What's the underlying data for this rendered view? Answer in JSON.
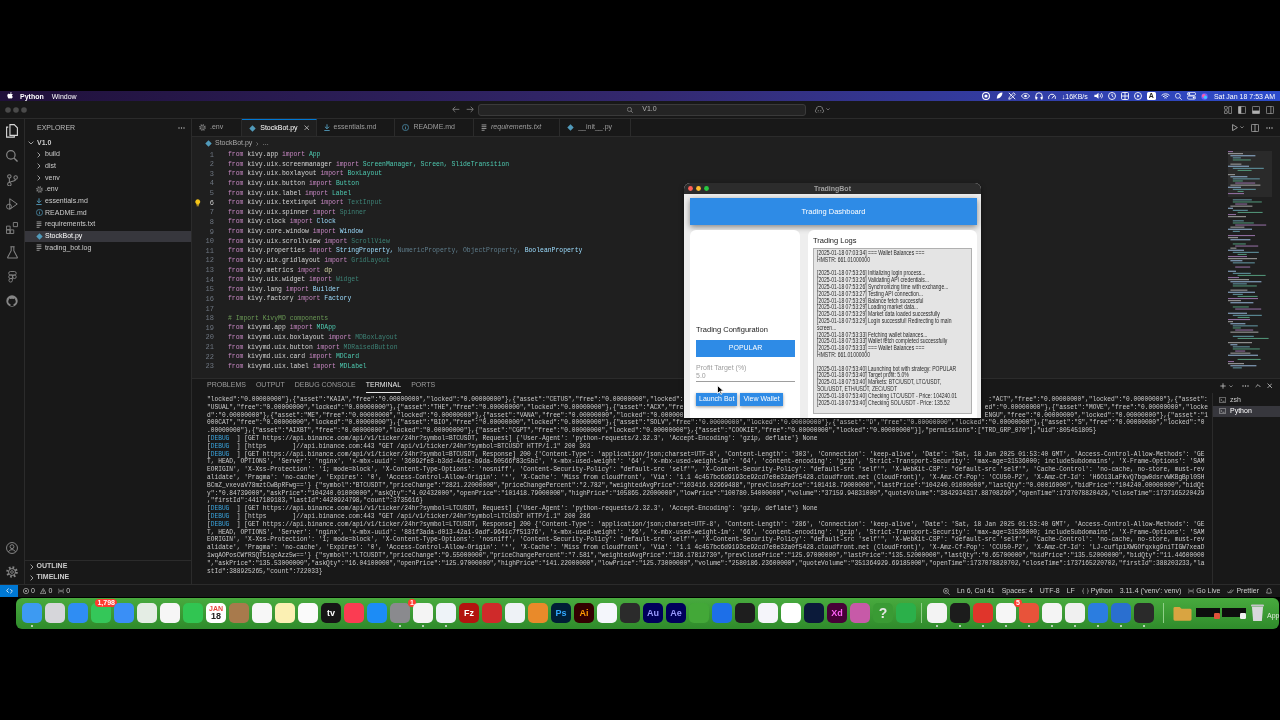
{
  "menu_bar": {
    "app": "Python",
    "menus": [
      "Window"
    ],
    "network_speed": "↓16KB/s",
    "input_source": "A",
    "clock": "Sat Jan 18 7:53 AM"
  },
  "title_bar": {
    "search": "V1.0"
  },
  "explorer": {
    "title": "EXPLORER",
    "tree": [
      {
        "label": "V1.0",
        "kind": "folder",
        "expanded": true,
        "selected": false,
        "children": [
          {
            "label": "build",
            "kind": "folder",
            "expanded": false,
            "selected": false
          },
          {
            "label": "dist",
            "kind": "folder",
            "expanded": false,
            "selected": false
          },
          {
            "label": "venv",
            "kind": "folder",
            "expanded": false,
            "selected": false
          },
          {
            "label": ".env",
            "kind": "env",
            "selected": false
          },
          {
            "label": "essentials.md",
            "kind": "markdown",
            "selected": false
          },
          {
            "label": "README.md",
            "kind": "info",
            "selected": false
          },
          {
            "label": "requirements.txt",
            "kind": "text",
            "selected": false
          },
          {
            "label": "StockBot.py",
            "kind": "python",
            "selected": true
          },
          {
            "label": "trading_bot.log",
            "kind": "text",
            "selected": false
          }
        ]
      }
    ],
    "sections": [
      {
        "label": "OUTLINE",
        "expanded": false
      },
      {
        "label": "TIMELINE",
        "expanded": false
      }
    ]
  },
  "tabs": [
    {
      "label": ".env",
      "kind": "env",
      "selected": false,
      "preview": false
    },
    {
      "label": "StockBot.py",
      "kind": "python",
      "selected": true,
      "preview": false
    },
    {
      "label": "essentials.md",
      "kind": "markdown",
      "selected": false,
      "preview": false
    },
    {
      "label": "README.md",
      "kind": "info",
      "selected": false,
      "preview": false
    },
    {
      "label": "requirements.txt",
      "kind": "text",
      "selected": false,
      "preview": true
    },
    {
      "label": "__init__.py",
      "kind": "python",
      "selected": false,
      "preview": false
    }
  ],
  "breadcrumb": [
    {
      "label": "StockBot.py",
      "kind": "python"
    },
    {
      "label": "...",
      "kind": "more"
    }
  ],
  "editor": {
    "lines": [
      {
        "number": "1",
        "current": false,
        "tokens": [
          {
            "kind": "keyword",
            "text": "from "
          },
          {
            "kind": "module",
            "text": "kivy.app "
          },
          {
            "kind": "keyword",
            "text": "import "
          },
          {
            "kind": "class",
            "text": "App"
          }
        ]
      },
      {
        "number": "2",
        "current": false,
        "tokens": [
          {
            "kind": "keyword",
            "text": "from "
          },
          {
            "kind": "module",
            "text": "kivy.uix.screenmanager "
          },
          {
            "kind": "keyword",
            "text": "import "
          },
          {
            "kind": "class",
            "text": "ScreenManager, Screen, SlideTransition"
          }
        ]
      },
      {
        "number": "3",
        "current": false,
        "tokens": [
          {
            "kind": "keyword",
            "text": "from "
          },
          {
            "kind": "module",
            "text": "kivy.uix.boxlayout "
          },
          {
            "kind": "keyword",
            "text": "import "
          },
          {
            "kind": "class",
            "text": "BoxLayout"
          }
        ]
      },
      {
        "number": "4",
        "current": false,
        "tokens": [
          {
            "kind": "keyword",
            "text": "from "
          },
          {
            "kind": "module",
            "text": "kivy.uix.button "
          },
          {
            "kind": "keyword",
            "text": "import "
          },
          {
            "kind": "class",
            "text": "Button"
          }
        ]
      },
      {
        "number": "5",
        "current": false,
        "tokens": [
          {
            "kind": "keyword",
            "text": "from "
          },
          {
            "kind": "module",
            "text": "kivy.uix.label "
          },
          {
            "kind": "keyword",
            "text": "import "
          },
          {
            "kind": "class",
            "text": "Label"
          }
        ]
      },
      {
        "number": "6",
        "current": true,
        "tokens": [
          {
            "kind": "keyword",
            "text": "from "
          },
          {
            "kind": "module",
            "text": "kivy.uix.textinput "
          },
          {
            "kind": "keyword",
            "text": "import "
          },
          {
            "kind": "unused",
            "text": "TextInput"
          }
        ]
      },
      {
        "number": "7",
        "current": false,
        "tokens": [
          {
            "kind": "keyword",
            "text": "from "
          },
          {
            "kind": "module",
            "text": "kivy.uix.spinner "
          },
          {
            "kind": "keyword",
            "text": "import "
          },
          {
            "kind": "unused",
            "text": "Spinner"
          }
        ]
      },
      {
        "number": "8",
        "current": false,
        "tokens": [
          {
            "kind": "keyword",
            "text": "from "
          },
          {
            "kind": "module",
            "text": "kivy.clock "
          },
          {
            "kind": "keyword",
            "text": "import "
          },
          {
            "kind": "name",
            "text": "Clock"
          }
        ]
      },
      {
        "number": "9",
        "current": false,
        "tokens": [
          {
            "kind": "keyword",
            "text": "from "
          },
          {
            "kind": "module",
            "text": "kivy.core.window "
          },
          {
            "kind": "keyword",
            "text": "import "
          },
          {
            "kind": "name",
            "text": "Window"
          }
        ]
      },
      {
        "number": "10",
        "current": false,
        "tokens": [
          {
            "kind": "keyword",
            "text": "from "
          },
          {
            "kind": "module",
            "text": "kivy.uix.scrollview "
          },
          {
            "kind": "keyword",
            "text": "import "
          },
          {
            "kind": "unused",
            "text": "ScrollView"
          }
        ]
      },
      {
        "number": "11",
        "current": false,
        "tokens": [
          {
            "kind": "keyword",
            "text": "from "
          },
          {
            "kind": "module",
            "text": "kivy.properties "
          },
          {
            "kind": "keyword",
            "text": "import "
          },
          {
            "kind": "name",
            "text": "StringProperty, "
          },
          {
            "kind": "unused_name",
            "text": "NumericProperty, ObjectProperty, "
          },
          {
            "kind": "name",
            "text": "BooleanProperty"
          }
        ]
      },
      {
        "number": "12",
        "current": false,
        "tokens": [
          {
            "kind": "keyword",
            "text": "from "
          },
          {
            "kind": "module",
            "text": "kivy.uix.gridlayout "
          },
          {
            "kind": "keyword",
            "text": "import "
          },
          {
            "kind": "unused",
            "text": "GridLayout"
          }
        ]
      },
      {
        "number": "13",
        "current": false,
        "tokens": [
          {
            "kind": "keyword",
            "text": "from "
          },
          {
            "kind": "module",
            "text": "kivy.metrics "
          },
          {
            "kind": "keyword",
            "text": "import "
          },
          {
            "kind": "function",
            "text": "dp"
          }
        ]
      },
      {
        "number": "14",
        "current": false,
        "tokens": [
          {
            "kind": "keyword",
            "text": "from "
          },
          {
            "kind": "module",
            "text": "kivy.uix.widget "
          },
          {
            "kind": "keyword",
            "text": "import "
          },
          {
            "kind": "unused",
            "text": "Widget"
          }
        ]
      },
      {
        "number": "15",
        "current": false,
        "tokens": [
          {
            "kind": "keyword",
            "text": "from "
          },
          {
            "kind": "module",
            "text": "kivy.lang "
          },
          {
            "kind": "keyword",
            "text": "import "
          },
          {
            "kind": "name",
            "text": "Builder"
          }
        ]
      },
      {
        "number": "16",
        "current": false,
        "tokens": [
          {
            "kind": "keyword",
            "text": "from "
          },
          {
            "kind": "module",
            "text": "kivy.factory "
          },
          {
            "kind": "keyword",
            "text": "import "
          },
          {
            "kind": "name",
            "text": "Factory"
          }
        ]
      },
      {
        "number": "17",
        "current": false
      },
      {
        "number": "18",
        "current": false,
        "tokens": [
          {
            "kind": "comment",
            "text": "# Import KivyMD components"
          }
        ]
      },
      {
        "number": "19",
        "current": false,
        "tokens": [
          {
            "kind": "keyword",
            "text": "from "
          },
          {
            "kind": "module",
            "text": "kivymd.app "
          },
          {
            "kind": "keyword",
            "text": "import "
          },
          {
            "kind": "class",
            "text": "MDApp"
          }
        ]
      },
      {
        "number": "20",
        "current": false,
        "tokens": [
          {
            "kind": "keyword",
            "text": "from "
          },
          {
            "kind": "module",
            "text": "kivymd.uix.boxlayout "
          },
          {
            "kind": "keyword",
            "text": "import "
          },
          {
            "kind": "unused",
            "text": "MDBoxLayout"
          }
        ]
      },
      {
        "number": "21",
        "current": false,
        "tokens": [
          {
            "kind": "keyword",
            "text": "from "
          },
          {
            "kind": "module",
            "text": "kivymd.uix.button "
          },
          {
            "kind": "keyword",
            "text": "import "
          },
          {
            "kind": "unused",
            "text": "MDRaisedButton"
          }
        ]
      },
      {
        "number": "22",
        "current": false,
        "tokens": [
          {
            "kind": "keyword",
            "text": "from "
          },
          {
            "kind": "module",
            "text": "kivymd.uix.card "
          },
          {
            "kind": "keyword",
            "text": "import "
          },
          {
            "kind": "class",
            "text": "MDCard"
          }
        ]
      },
      {
        "number": "23",
        "current": false,
        "tokens": [
          {
            "kind": "keyword",
            "text": "from "
          },
          {
            "kind": "module",
            "text": "kivymd.uix.label "
          },
          {
            "kind": "keyword",
            "text": "import "
          },
          {
            "kind": "class",
            "text": "MDLabel"
          }
        ]
      }
    ]
  },
  "panel": {
    "tabs": [
      {
        "label": "PROBLEMS",
        "selected": false
      },
      {
        "label": "OUTPUT",
        "selected": false
      },
      {
        "label": "DEBUG CONSOLE",
        "selected": false
      },
      {
        "label": "TERMINAL",
        "selected": true
      },
      {
        "label": "PORTS",
        "selected": false
      }
    ],
    "terminal": {
      "rows": [
        {
          "kind": "split",
          "left": "\"locked\":\"0.00000000\"},{\"asset\":\"KAIA\",\"free\":\"0.00000000\",\"locked\":\"0.00000000\"},{\"asset\":\"CETUS\",\"free\":\"0.00000000\",\"locked\":",
          "right": ":\"ACT\",\"free\":\"0.00000000\",\"locked\":\"0.00000000\"},{\"asset\":"
        },
        {
          "kind": "split",
          "left": "\"USUAL\",\"free\":\"0.00000000\",\"locked\":\"0.00000000\"},{\"asset\":\"THE\",\"free\":\"0.00000000\",\"locked\":\"0.00000000\"},{\"asset\":\"ACX\",\"fre",
          "right": "ed\":\"0.00000000\"},{\"asset\":\"MOVE\",\"free\":\"0.00000000\",\"locke"
        },
        {
          "kind": "split",
          "left": "d\":\"0.00000000\"},{\"asset\":\"ME\",\"free\":\"0.00000000\",\"locked\":\"0.00000000\"},{\"asset\":\"VANA\",\"free\":\"0.00000000\",\"locked\":\"0.000000",
          "right": "ENGU\",\"free\":\"0.00000000\",\"locked\":\"0.00000000\"},{\"asset\":\"1"
        },
        {
          "kind": "line",
          "segments": [
            {
              "kind": "plain",
              "text": "000CAT\",\"free\":\"0.00000000\",\"locked\":\"0.00000000\"},{\"asset\":\"BIO\",\"free\":\"0.00000000\",\"locked\":\"0.00000000\"},{\"asset\":\"SOLV\",\"free\":\"0.00000000\",\"locked\":\"0.00000000\"},{\"asset\":\"D\",\"free\":\"0.00000000\",\"locked\":\"0.00000000\"},{\"asset\":\"S\",\"free\":\"0.00000000\",\"locked\":\"0"
            }
          ]
        },
        {
          "kind": "line",
          "segments": [
            {
              "kind": "plain",
              "text": ".00000000\"},{\"asset\":\"AIXBT\",\"free\":\"0.00000000\",\"locked\":\"0.00000000\"},{\"asset\":\"CGPT\",\"free\":\"0.00000000\",\"locked\":\"0.00000000\"},{\"asset\":\"COOKIE\",\"free\":\"0.00000000\",\"locked\":\"0.00000000\"}],\"permissions\":[\"TRD_GRP_070\"],\"uid\":805451805}"
            }
          ]
        },
        {
          "kind": "line",
          "segments": [
            {
              "kind": "plain",
              "text": "["
            },
            {
              "kind": "level",
              "text": "DEBUG"
            },
            {
              "kind": "plain",
              "text": "  ] [GET https://api.binance.com/api/v1/ticker/24hr?symbol=BTCUSDT, Request] {'User-Agent': 'python-requests/2.32.3', 'Accept-Encoding': 'gzip, deflate'} None"
            }
          ]
        },
        {
          "kind": "line",
          "segments": [
            {
              "kind": "plain",
              "text": "["
            },
            {
              "kind": "level",
              "text": "DEBUG"
            },
            {
              "kind": "plain",
              "text": "  ] [https       ]//api.binance.com:443 \"GET /api/v1/ticker/24hr?symbol=BTCUSDT HTTP/1.1\" 200 303"
            }
          ]
        },
        {
          "kind": "line",
          "segments": [
            {
              "kind": "plain",
              "text": "["
            },
            {
              "kind": "level",
              "text": "DEBUG"
            },
            {
              "kind": "plain",
              "text": "  ] [GET https://api.binance.com/api/v1/ticker/24hr?symbol=BTCUSDT, Response] 200 {'Content-Type': 'application/json;charset=UTF-8', 'Content-Length': '303', 'Connection': 'keep-alive', 'Date': 'Sat, 18 Jan 2025 01:53:40 GMT', 'Access-Control-Allow-Methods': 'GE"
            }
          ]
        },
        {
          "kind": "line",
          "segments": [
            {
              "kind": "plain",
              "text": "T, HEAD, OPTIONS', 'Server': 'nginx', 'x-mbx-uuid': '36092fe8-b3dd-4d1e-b9da-60566f83c5bc', 'x-mbx-used-weight': '64', 'x-mbx-used-weight-1m': '64', 'content-encoding': 'gzip', 'Strict-Transport-Security': 'max-age=31536000; includeSubdomains', 'X-Frame-Options': 'SAM"
            }
          ]
        },
        {
          "kind": "line",
          "segments": [
            {
              "kind": "plain",
              "text": "EORIGIN', 'X-Xss-Protection': '1; mode=block', 'X-Content-Type-Options': 'nosniff', 'Content-Security-Policy': \"default-src 'self'\", 'X-Content-Security-Policy': \"default-src 'self'\", 'X-WebKit-CSP': \"default-src 'self'\", 'Cache-Control': 'no-cache, no-store, must-rev"
            }
          ]
        },
        {
          "kind": "line",
          "segments": [
            {
              "kind": "plain",
              "text": "alidate', 'Pragma': 'no-cache', 'Expires': '0', 'Access-Control-Allow-Origin': '*', 'X-Cache': 'Miss from cloudfront', 'Via': '1.1 4c457bc6d9193ce92cd7e0e32a0f5428.cloudfront.net (CloudFront)', 'X-Amz-Cf-Pop': 'CCU50-P2', 'X-Amz-Cf-Id': 'H6Oi3LaFKvQ7bgw0dsrvWKBgBpl0SH"
            }
          ]
        },
        {
          "kind": "line",
          "segments": [
            {
              "kind": "plain",
              "text": "BCmZ_vxevaV78mztCwBpRFwg=='} {\"symbol\":\"BTCUSDT\",\"priceChange\":\"2821.22000000\",\"priceChangePercent\":\"2.782\",\"weightedAvgPrice\":\"103416.02969488\",\"prevClosePrice\":\"101418.79000000\",\"lastPrice\":\"104240.01000000\",\"lastQty\":\"0.00016000\",\"bidPrice\":\"104240.00000000\",\"bidQt"
            }
          ]
        },
        {
          "kind": "line",
          "segments": [
            {
              "kind": "plain",
              "text": "y\":\"0.84739000\",\"askPrice\":\"104240.01000000\",\"askQty\":\"4.02432000\",\"openPrice\":\"101418.79000000\",\"highPrice\":\"105865.22000000\",\"lowPrice\":\"100780.54000000\",\"volume\":\"37159.94831000\",\"quoteVolume\":\"3842934317.88708260\",\"openTime\":1737078820429,\"closeTime\":1737165220429"
            }
          ]
        },
        {
          "kind": "line",
          "segments": [
            {
              "kind": "plain",
              "text": ",\"firstId\":4417189183,\"lastId\":4420924798,\"count\":3735616}"
            }
          ]
        },
        {
          "kind": "line",
          "segments": [
            {
              "kind": "plain",
              "text": "["
            },
            {
              "kind": "level",
              "text": "DEBUG"
            },
            {
              "kind": "plain",
              "text": "  ] [GET https://api.binance.com/api/v1/ticker/24hr?symbol=LTCUSDT, Request] {'User-Agent': 'python-requests/2.32.3', 'Accept-Encoding': 'gzip, deflate'} None"
            }
          ]
        },
        {
          "kind": "line",
          "segments": [
            {
              "kind": "plain",
              "text": "["
            },
            {
              "kind": "level",
              "text": "DEBUG"
            },
            {
              "kind": "plain",
              "text": "  ] [https       ]//api.binance.com:443 \"GET /api/v1/ticker/24hr?symbol=LTCUSDT HTTP/1.1\" 200 286"
            }
          ]
        },
        {
          "kind": "line",
          "segments": [
            {
              "kind": "plain",
              "text": "["
            },
            {
              "kind": "level",
              "text": "DEBUG"
            },
            {
              "kind": "plain",
              "text": "  ] [GET https://api.binance.com/api/v1/ticker/24hr?symbol=LTCUSDT, Response] 200 {'Content-Type': 'application/json;charset=UTF-8', 'Content-Length': '286', 'Connection': 'keep-alive', 'Date': 'Sat, 18 Jan 2025 01:53:40 GMT', 'Access-Control-Allow-Methods': 'GE"
            }
          ]
        },
        {
          "kind": "line",
          "segments": [
            {
              "kind": "plain",
              "text": "T, HEAD, OPTIONS', 'Server': 'nginx', 'x-mbx-uuid': '881f3ada-d013-42a1-9adf-9641c7f51376', 'x-mbx-used-weight': '66', 'x-mbx-used-weight-1m': '66', 'content-encoding': 'gzip', 'Strict-Transport-Security': 'max-age=31536000; includeSubdomains', 'X-Frame-Options': 'SAM"
            }
          ]
        },
        {
          "kind": "line",
          "segments": [
            {
              "kind": "plain",
              "text": "EORIGIN', 'X-Xss-Protection': '1; mode=block', 'X-Content-Type-Options': 'nosniff', 'Content-Security-Policy': \"default-src 'self'\", 'X-Content-Security-Policy': \"default-src 'self'\", 'X-WebKit-CSP': \"default-src 'self'\", 'Cache-Control': 'no-cache, no-store, must-rev"
            }
          ]
        },
        {
          "kind": "line",
          "segments": [
            {
              "kind": "plain",
              "text": "alidate', 'Pragma': 'no-cache', 'Expires': '0', 'Access-Control-Allow-Origin': '*', 'X-Cache': 'Miss from cloudfront', 'Via': '1.1 4c457bc6d9193ce92cd7e0e32a0f5428.cloudfront.net (CloudFront)', 'X-Amz-Cf-Pop': 'CCU50-P2', 'X-Amz-Cf-Id': 'LJ-cuflpiXWGOfqxkg9niTIGW7xeaD"
            }
          ]
        },
        {
          "kind": "line",
          "segments": [
            {
              "kind": "plain",
              "text": "1wqAOPosCWfRSQT51qcAzz5w=='} {\"symbol\":\"LTCUSDT\",\"priceChange\":\"9.55000000\",\"priceChangePercent\":\"7.581\",\"weightedAvgPrice\":\"136.17812730\",\"prevClosePrice\":\"125.97000000\",\"lastPrice\":\"135.52000000\",\"lastQty\":\"0.65700000\",\"bidPrice\":\"135.52000000\",\"bidQty\":\"11.44600000"
            }
          ]
        },
        {
          "kind": "line",
          "segments": [
            {
              "kind": "plain",
              "text": "\",\"askPrice\":\"135.53000000\",\"askQty\":\"16.04100000\",\"openPrice\":\"125.97000000\",\"highPrice\":\"141.22000000\",\"lowPrice\":\"125.73000000\",\"volume\":\"2580186.23600000\",\"quoteVolume\":\"351364929.69185000\",\"openTime\":1737078820702,\"closeTime\":1737165220702,\"firstId\":388203233,\"la"
            }
          ]
        },
        {
          "kind": "line",
          "segments": [
            {
              "kind": "plain",
              "text": "stId\":388925265,\"count\":722033}"
            }
          ]
        }
      ]
    },
    "sessions": [
      {
        "label": "zsh",
        "selected": false
      },
      {
        "label": "Python",
        "selected": true
      }
    ]
  },
  "status_bar": {
    "errors": "0",
    "warnings": "0",
    "ports": "0",
    "items": [
      {
        "kind": "zoom"
      },
      {
        "kind": "text",
        "text": "Ln 6, Col 41"
      },
      {
        "kind": "text",
        "text": "Spaces: 4"
      },
      {
        "kind": "text",
        "text": "UTF-8"
      },
      {
        "kind": "text",
        "text": "LF"
      },
      {
        "kind": "braces",
        "text": "Python"
      },
      {
        "kind": "text",
        "text": "3.11.4 ('venv': venv)"
      },
      {
        "kind": "live",
        "text": "Go Live"
      },
      {
        "kind": "prettier",
        "text": "Prettier"
      },
      {
        "kind": "bell"
      }
    ]
  },
  "app_window": {
    "title": "TradingBot",
    "header": "Trading Dashboard",
    "config": {
      "title": "Trading Configuration",
      "strategy": "POPULAR",
      "field": {
        "label": "Profit Target (%)",
        "value": "5.0"
      },
      "buttons": [
        "Launch Bot",
        "View Wallet"
      ]
    },
    "logs": {
      "title": "Trading Logs",
      "blocks": [
        [
          "[2025-01-18 07:03:34] === Wallet Balances ===",
          "HMSTR: 661.01000000"
        ],
        [
          "[2025-01-18 07:53:26] Initializing login process...",
          "[2025-01-18 07:53:26] Validating API credentials...",
          "[2025-01-18 07:53:26] Synchronizing time with exchange...",
          "[2025-01-18 07:53:27] Testing API connection...",
          "[2025-01-18 07:53:29] Balance fetch successful",
          "[2025-01-18 07:53:29] Loading market data...",
          "[2025-01-18 07:53:29] Market data loaded successfully",
          "[2025-01-18 07:53:29] Login successful! Redirecting to main screen...",
          "[2025-01-18 07:53:33] Fetching wallet balances...",
          "[2025-01-18 07:53:33] Wallet fetch completed successfully",
          "[2025-01-18 07:53:33] === Wallet Balances ===",
          "HMSTR: 661.01000000"
        ],
        [
          "[2025-01-18 07:53:40] Launching bot with strategy: POPULAR",
          "[2025-01-18 07:53:40] Target profit: 5.0%",
          "[2025-01-18 07:53:40] Markets: BTC/USDT, LTC/USDT, SOL/USDT, ETH/USDT, ZEC/USDT",
          "[2025-01-18 07:53:40] Checking LTC/USDT - Price: 104240.01",
          "[2025-01-18 07:53:40] Checking SOL/USDT - Price: 135.52"
        ]
      ]
    }
  },
  "dock": {
    "groups": [
      [
        {
          "color": "#3d9af2",
          "running": true
        },
        {
          "color": "#d6d6da",
          "running": false
        },
        {
          "color": "#2f8df3",
          "running": false
        },
        {
          "color": "#34c759",
          "badge": "1,798",
          "running": false
        },
        {
          "color": "#3a8ff6",
          "running": false
        },
        {
          "color": "#e4ede4",
          "running": false
        },
        {
          "color": "#f6f6f6",
          "running": false
        },
        {
          "color": "#31c552",
          "running": false
        },
        {
          "color": "#ffffff",
          "labels": [
            {
              "text": "JAN",
              "color": "#e8453c"
            },
            {
              "text": "18",
              "color": "#222222"
            }
          ],
          "running": false
        },
        {
          "color": "#a87a4c",
          "running": false
        },
        {
          "color": "#f7f7f7",
          "running": false
        },
        {
          "color": "#fbf0b3",
          "running": false
        },
        {
          "color": "#fafafa",
          "running": false
        },
        {
          "color": "#161616",
          "labels": [
            {
              "text": "tv",
              "color": "#ffffff"
            }
          ],
          "running": false
        },
        {
          "color": "#fb3c52",
          "running": false
        },
        {
          "color": "#1c8cf6",
          "running": false
        },
        {
          "color": "#8a8a8e",
          "badge": "1",
          "running": true
        },
        {
          "color": "#f4f4f4",
          "running": true
        },
        {
          "color": "#eef3f8",
          "running": true
        },
        {
          "color": "#b3140f",
          "labels": [
            {
              "text": "Fz",
              "color": "#ffffff"
            }
          ],
          "running": false
        },
        {
          "color": "#cf2a2a",
          "running": false
        },
        {
          "color": "#eef2f6",
          "running": false
        },
        {
          "color": "#e98a2a",
          "running": false
        },
        {
          "color": "#001e36",
          "labels": [
            {
              "text": "Ps",
              "color": "#31a8ff"
            }
          ],
          "running": false
        },
        {
          "color": "#330000",
          "labels": [
            {
              "text": "Ai",
              "color": "#ff9a00"
            }
          ],
          "running": false
        },
        {
          "color": "#f4f6fb",
          "running": false
        },
        {
          "color": "#2b2b2b",
          "running": false
        },
        {
          "color": "#00005b",
          "labels": [
            {
              "text": "Au",
              "color": "#9999ff"
            }
          ],
          "running": false
        },
        {
          "color": "#00005b",
          "labels": [
            {
              "text": "Ae",
              "color": "#9999ff"
            }
          ],
          "running": false
        },
        {
          "color": "#43a838",
          "running": false
        },
        {
          "color": "#1d6fe8",
          "running": false
        },
        {
          "color": "#1e1e1e",
          "running": false
        },
        {
          "color": "#f5f5fa",
          "running": false
        },
        {
          "color": "#ffffff",
          "running": false
        },
        {
          "color": "#0b1a3a",
          "running": false
        },
        {
          "color": "#470137",
          "labels": [
            {
              "text": "Xd",
              "color": "#ff61f6"
            }
          ],
          "running": false
        },
        {
          "color": "#c75aa8",
          "running": false
        },
        {
          "color": "#3a9b34",
          "labels": [
            {
              "text": "?",
              "color": "#e6e6e6"
            }
          ],
          "running": false
        },
        {
          "color": "#2bb04a",
          "running": false
        }
      ],
      [
        {
          "color": "#f3f3f3",
          "running": true
        },
        {
          "color": "#1c1c1c",
          "running": true
        },
        {
          "color": "#e0352b",
          "running": true
        },
        {
          "color": "#f6f6f6",
          "badge": "5",
          "running": true
        },
        {
          "color": "#e8533a",
          "running": true
        },
        {
          "color": "#f4f4f4",
          "running": true
        },
        {
          "color": "#f0f0f0",
          "running": true
        },
        {
          "color": "#2b7de0",
          "running": true
        },
        {
          "color": "#2a6fd0",
          "running": true
        },
        {
          "color": "#2a2a2a",
          "running": true
        }
      ]
    ],
    "edge_label": "App"
  }
}
